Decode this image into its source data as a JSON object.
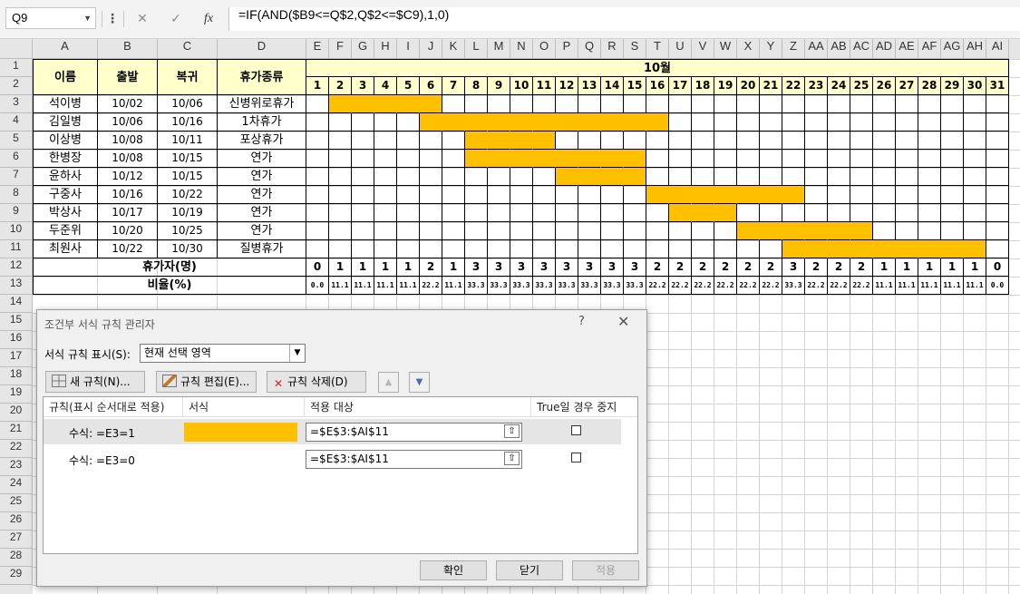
{
  "formula_bar": {
    "cell_ref": "Q9",
    "cancel_icon": "✕",
    "confirm_icon": "✓",
    "fx_label": "fx",
    "formula": "=IF(AND($B9<=Q$2,Q$2<=$C9),1,0)"
  },
  "columns": [
    "A",
    "B",
    "C",
    "D",
    "E",
    "F",
    "G",
    "H",
    "I",
    "J",
    "K",
    "L",
    "M",
    "N",
    "O",
    "P",
    "Q",
    "R",
    "S",
    "T",
    "U",
    "V",
    "W",
    "X",
    "Y",
    "Z",
    "AA",
    "AB",
    "AC",
    "AD",
    "AE",
    "AF",
    "AG",
    "AH",
    "AI"
  ],
  "rows": [
    "1",
    "2",
    "3",
    "4",
    "5",
    "6",
    "7",
    "8",
    "9",
    "10",
    "11",
    "12",
    "13",
    "14",
    "15",
    "16",
    "17",
    "18",
    "19",
    "20",
    "21",
    "22",
    "23",
    "24",
    "25",
    "26",
    "27",
    "28",
    "29"
  ],
  "table": {
    "headers": {
      "name": "이름",
      "start": "출발",
      "return": "복귀",
      "type": "휴가종류",
      "month": "10월"
    },
    "days": [
      "1",
      "2",
      "3",
      "4",
      "5",
      "6",
      "7",
      "8",
      "9",
      "10",
      "11",
      "12",
      "13",
      "14",
      "15",
      "16",
      "17",
      "18",
      "19",
      "20",
      "21",
      "22",
      "23",
      "24",
      "25",
      "26",
      "27",
      "28",
      "29",
      "30",
      "31"
    ],
    "records": [
      {
        "name": "석이병",
        "start": "10/02",
        "return": "10/06",
        "type": "신병위로휴가",
        "from_day": 2,
        "to_day": 6
      },
      {
        "name": "김일병",
        "start": "10/06",
        "return": "10/16",
        "type": "1차휴가",
        "from_day": 6,
        "to_day": 16
      },
      {
        "name": "이상병",
        "start": "10/08",
        "return": "10/11",
        "type": "포상휴가",
        "from_day": 8,
        "to_day": 11
      },
      {
        "name": "한병장",
        "start": "10/08",
        "return": "10/15",
        "type": "연가",
        "from_day": 8,
        "to_day": 15
      },
      {
        "name": "윤하사",
        "start": "10/12",
        "return": "10/15",
        "type": "연가",
        "from_day": 12,
        "to_day": 15
      },
      {
        "name": "구중사",
        "start": "10/16",
        "return": "10/22",
        "type": "연가",
        "from_day": 16,
        "to_day": 22
      },
      {
        "name": "박상사",
        "start": "10/17",
        "return": "10/19",
        "type": "연가",
        "from_day": 17,
        "to_day": 19
      },
      {
        "name": "두준위",
        "start": "10/20",
        "return": "10/25",
        "type": "연가",
        "from_day": 20,
        "to_day": 25
      },
      {
        "name": "최원사",
        "start": "10/22",
        "return": "10/30",
        "type": "질병휴가",
        "from_day": 22,
        "to_day": 30
      }
    ],
    "count_label": "휴가자(명)",
    "counts": [
      "0",
      "1",
      "1",
      "1",
      "1",
      "2",
      "1",
      "3",
      "3",
      "3",
      "3",
      "3",
      "3",
      "3",
      "3",
      "2",
      "2",
      "2",
      "2",
      "2",
      "2",
      "3",
      "2",
      "2",
      "2",
      "1",
      "1",
      "1",
      "1",
      "1",
      "0"
    ],
    "ratio_label": "비율(%)",
    "ratios": [
      "0.0",
      "11.1",
      "11.1",
      "11.1",
      "11.1",
      "22.2",
      "11.1",
      "33.3",
      "33.3",
      "33.3",
      "33.3",
      "33.3",
      "33.3",
      "33.3",
      "33.3",
      "22.2",
      "22.2",
      "22.2",
      "22.2",
      "22.2",
      "22.2",
      "33.3",
      "22.2",
      "22.2",
      "22.2",
      "11.1",
      "11.1",
      "11.1",
      "11.1",
      "11.1",
      "0.0"
    ],
    "bar_color": "#ffc000"
  },
  "dialog": {
    "title": "조건부 서식 규칙 관리자",
    "help": "?",
    "close": "✕",
    "show_label": "서식 규칙 표시(S):",
    "show_value": "현재 선택 영역",
    "new_rule": "새 규칙(N)...",
    "edit_rule": "규칙 편집(E)...",
    "delete_rule": "규칙 삭제(D)",
    "col_rule": "규칙(표시 순서대로 적용)",
    "col_format": "서식",
    "col_applies": "적용 대상",
    "col_stop": "True일 경우 중지",
    "rules": [
      {
        "label": "수식: =E3=1",
        "format_color": "#ffc000",
        "applies_to": "=$E$3:$AI$11"
      },
      {
        "label": "수식: =E3=0",
        "format_color": "",
        "applies_to": "=$E$3:$AI$11"
      }
    ],
    "ok": "확인",
    "close_btn": "닫기",
    "apply": "적용"
  }
}
